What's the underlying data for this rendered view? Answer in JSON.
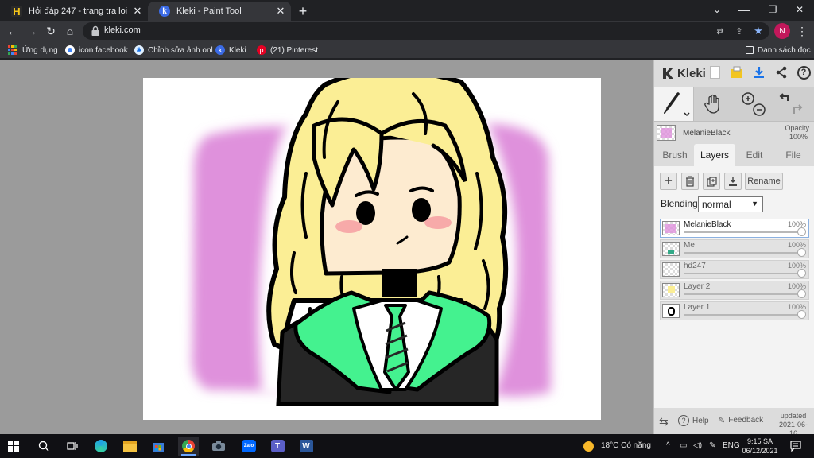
{
  "browser": {
    "tabs": [
      {
        "title": "Hỏi đáp 247 - trang tra loi",
        "favicon": "hoidap-logo-icon",
        "active": false
      },
      {
        "title": "Kleki - Paint Tool",
        "favicon": "kleki-logo-icon",
        "active": true
      }
    ],
    "window_controls": {
      "minimize": "⌄ —",
      "restore": "❐",
      "close": "✕"
    },
    "url": "kleki.com",
    "profile_initial": "N",
    "bookmarks": [
      {
        "label": "Ứng dụng",
        "icon": "apps-grid-icon"
      },
      {
        "label": "icon facebook",
        "icon": "dot-icon"
      },
      {
        "label": "Chỉnh sửa ảnh onl",
        "icon": "photo-editor-icon"
      },
      {
        "label": "Kleki",
        "icon": "kleki-logo-icon"
      },
      {
        "label": "(21) Pinterest",
        "icon": "pinterest-icon"
      }
    ],
    "reading_list": "Danh sách đọc"
  },
  "kleki": {
    "brand": "Kleki",
    "current_layer": {
      "name": "MelanieBlack",
      "opacity_label": "Opacity",
      "opacity_value": "100%"
    },
    "tabs": [
      "Brush",
      "Layers",
      "Edit",
      "File"
    ],
    "active_tab": "Layers",
    "layer_buttons": {
      "rename": "Rename"
    },
    "blending_label": "Blending",
    "blending_value": "normal",
    "layers": [
      {
        "name": "MelanieBlack",
        "opacity": "100%",
        "selected": true
      },
      {
        "name": "Me",
        "opacity": "100%",
        "selected": false
      },
      {
        "name": "hd247",
        "opacity": "100%",
        "selected": false
      },
      {
        "name": "Layer 2",
        "opacity": "100%",
        "selected": false
      },
      {
        "name": "Layer 1",
        "opacity": "100%",
        "selected": false
      }
    ],
    "footer": {
      "help": "Help",
      "feedback": "Feedback",
      "updated_label": "updated",
      "updated_date": "2021-06-16"
    }
  },
  "taskbar": {
    "weather": "18°C  Có nắng",
    "language": "ENG",
    "time": "9:15 SA",
    "date": "06/12/2021",
    "apps": [
      "windows-start-icon",
      "search-icon",
      "task-view-icon",
      "edge-icon",
      "file-explorer-icon",
      "store-icon",
      "chrome-icon",
      "camera-icon",
      "zalo-icon",
      "teams-icon",
      "word-icon"
    ]
  },
  "colors": {
    "hair": "#fbee95",
    "skin": "#fdebd0",
    "lilac": "#df91dc",
    "green": "#44f28f",
    "blush": "#f7aaa9",
    "cloak": "#262626"
  }
}
